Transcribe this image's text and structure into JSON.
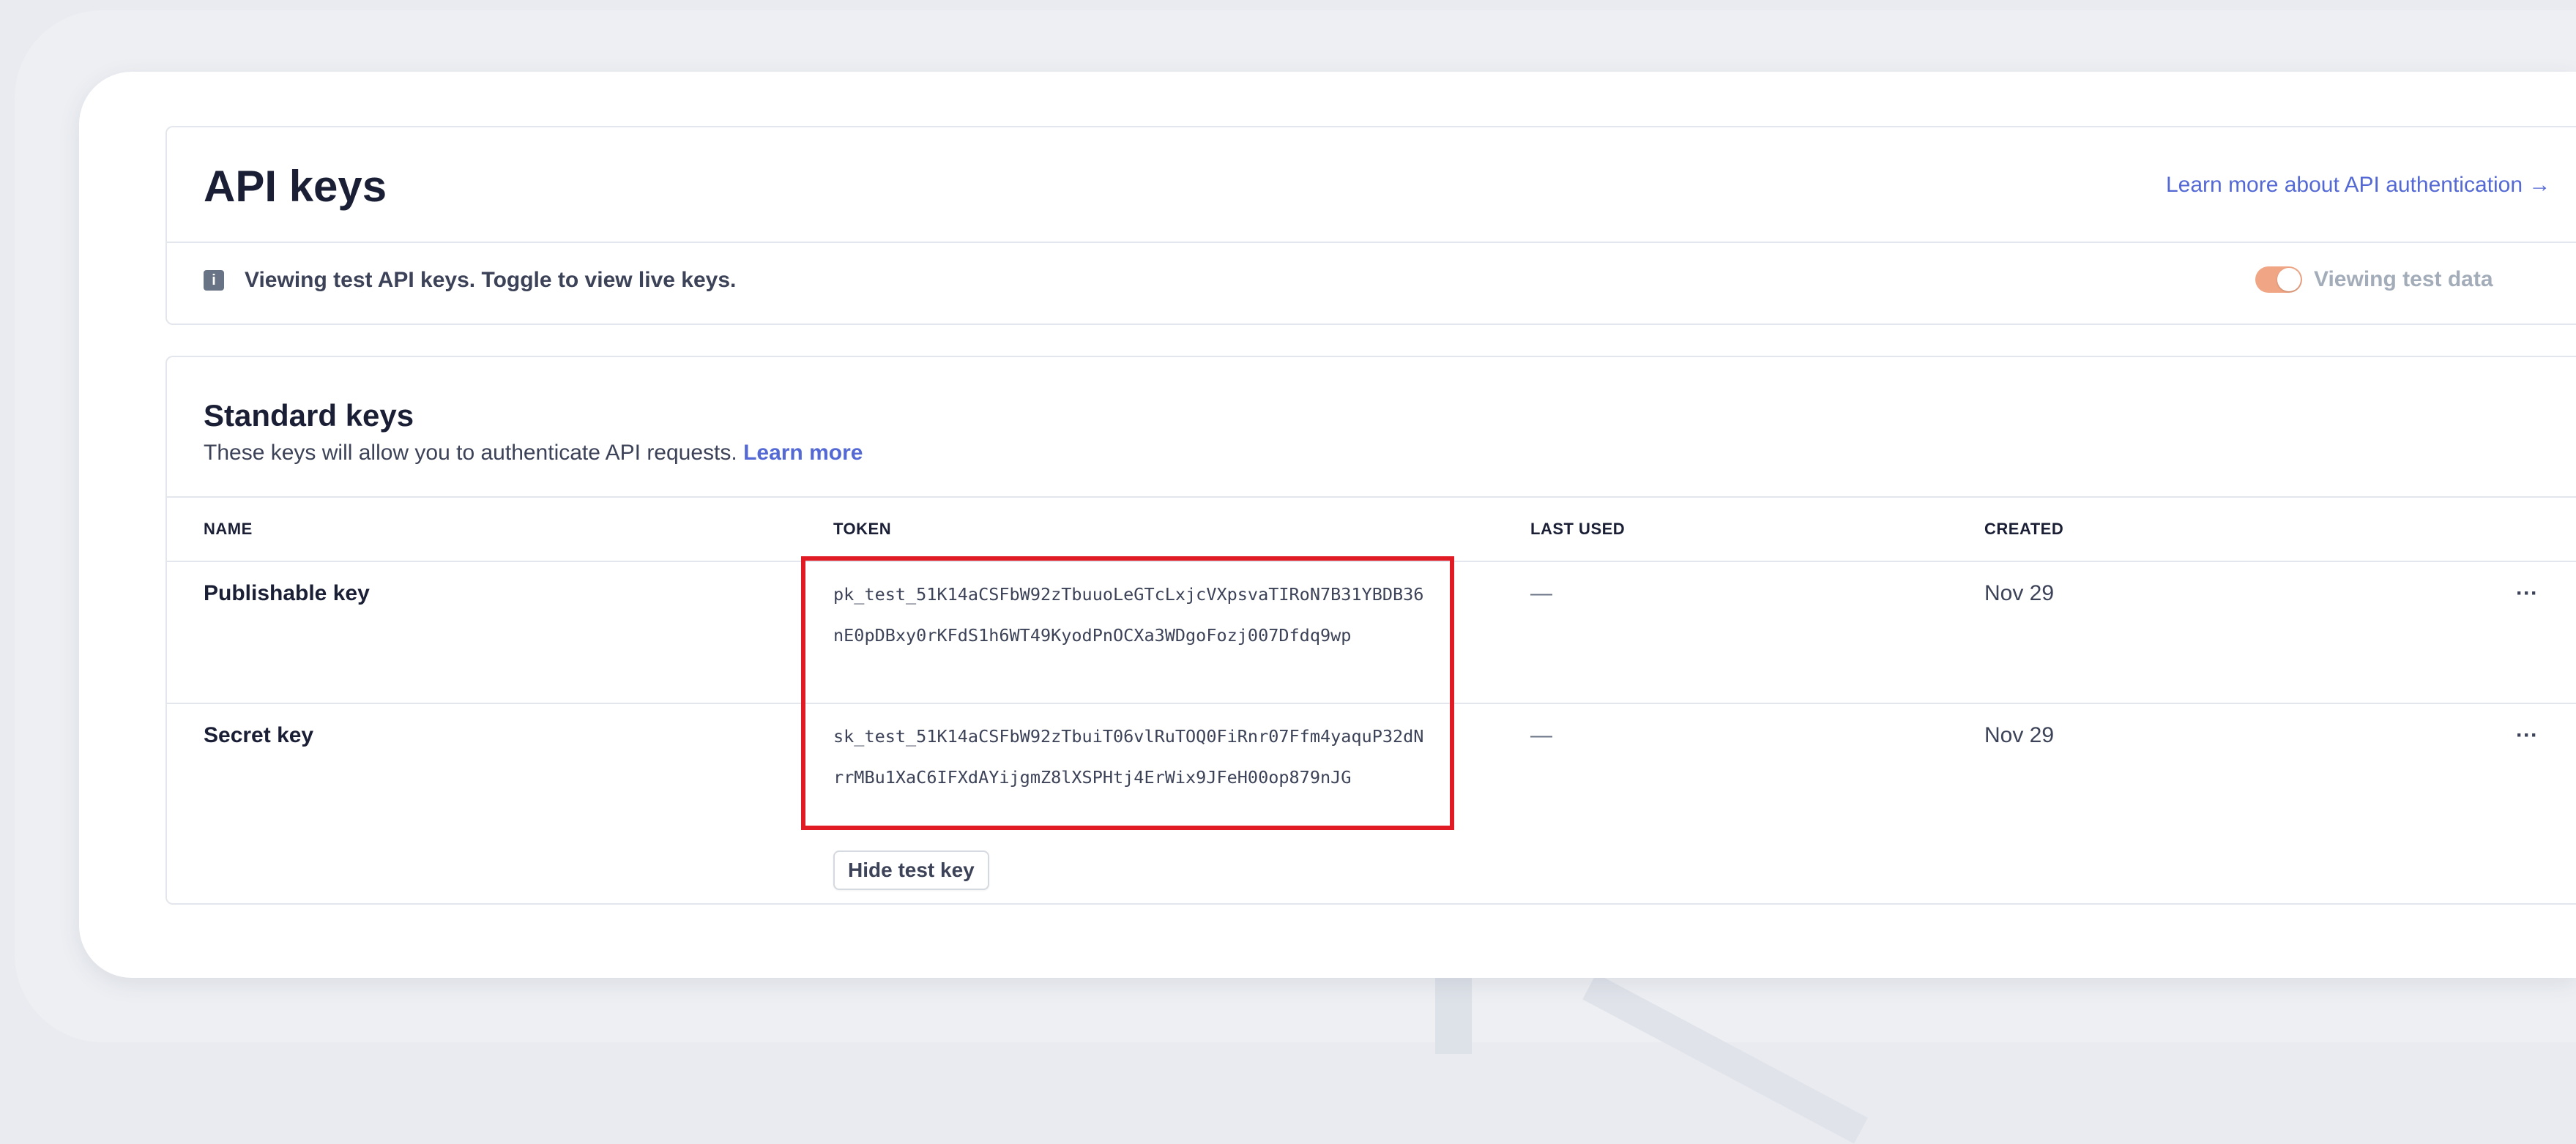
{
  "header": {
    "title": "API keys",
    "learn_link": "Learn more about API authentication →",
    "info_text": "Viewing test API keys. Toggle to view live keys.",
    "toggle_label": "Viewing test data",
    "toggle_on": true
  },
  "standard_keys": {
    "title": "Standard keys",
    "description": "These keys will allow you to authenticate API requests.",
    "learn_more": "Learn more",
    "columns": [
      "NAME",
      "TOKEN",
      "LAST USED",
      "CREATED"
    ],
    "rows": [
      {
        "name": "Publishable key",
        "token": "pk_test_51K14aCSFbW92zTbuuoLeGTcLxjcVXpsvaTIRoN7B31YBDB36nE0pDBxy0rKFdS1h6WT49KyodPnOCXa3WDgoFozj007Dfdq9wp",
        "last_used": "—",
        "created": "Nov 29",
        "more": "···"
      },
      {
        "name": "Secret key",
        "token": "sk_test_51K14aCSFbW92zTbuiT06vlRuTOQ0FiRnr07Ffm4yaquP32dNrrMBu1XaC6IFXdAYijgmZ8lXSPHtj4ErWix9JFeH00op879nJG",
        "last_used": "—",
        "created": "Nov 29",
        "more": "···",
        "hide_button": "Hide test key"
      }
    ]
  },
  "colors": {
    "accent": "#5469d4",
    "toggle": "#f0a584",
    "highlight": "#e01b24"
  }
}
